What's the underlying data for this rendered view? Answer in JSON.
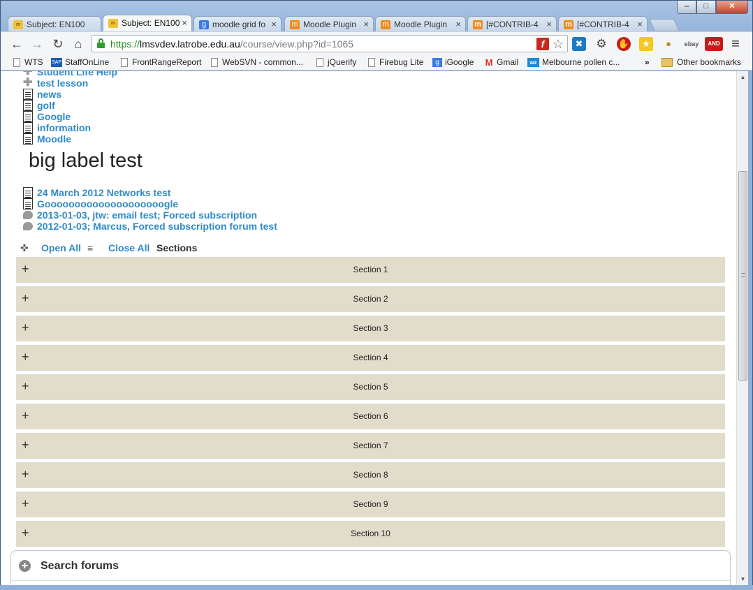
{
  "window": {
    "min": "–",
    "max": "□",
    "close": "✕"
  },
  "tabs": [
    {
      "title": "Subject: EN100",
      "icon": "moodle-icon",
      "active": false
    },
    {
      "title": "Subject: EN100",
      "icon": "moodle-icon",
      "active": true
    },
    {
      "title": "moodle grid fo",
      "icon": "google-icon",
      "active": false
    },
    {
      "title": "Moodle Plugin",
      "icon": "moodle-hat-icon",
      "active": false
    },
    {
      "title": "Moodle Plugin",
      "icon": "moodle-hat-icon",
      "active": false
    },
    {
      "title": "[#CONTRIB-4",
      "icon": "moodle-m-icon",
      "active": false
    },
    {
      "title": "[#CONTRIB-4",
      "icon": "moodle-m-icon",
      "active": false
    }
  ],
  "tab_close": "×",
  "nav": {
    "back": "←",
    "forward": "→",
    "reload": "↻",
    "home": "⌂"
  },
  "address": {
    "protocol": "https://",
    "host": "lmsvdev.latrobe.edu.au",
    "path": "/course/view.php?id=1065"
  },
  "toolbar_icons": {
    "flash": "f",
    "star": "☆",
    "ext1": "✖",
    "settings": "⚙",
    "adblock": "✋",
    "ext2": "★",
    "cookie": "●",
    "ebay": "ebay",
    "and": "AND",
    "menu": "≡"
  },
  "bookmarks": [
    {
      "label": "WTS",
      "icon": "page-icon"
    },
    {
      "label": "StaffOnLine",
      "icon": "sap-icon"
    },
    {
      "label": "FrontRangeReport",
      "icon": "page-icon"
    },
    {
      "label": "WebSVN - common...",
      "icon": "page-icon"
    },
    {
      "label": "jQuerify",
      "icon": "page-icon"
    },
    {
      "label": "Firebug Lite",
      "icon": "page-icon"
    },
    {
      "label": "iGoogle",
      "icon": "google-icon"
    },
    {
      "label": "Gmail",
      "icon": "gmail-icon"
    },
    {
      "label": "Melbourne pollen c...",
      "icon": "wz-icon"
    }
  ],
  "bookmarks_overflow": "»",
  "other_bookmarks": "Other bookmarks",
  "resources_top": [
    {
      "label": "Student Life Help",
      "type": "lesson"
    },
    {
      "label": "test lesson",
      "type": "lesson"
    },
    {
      "label": "news",
      "type": "doc"
    },
    {
      "label": "golf",
      "type": "doc"
    },
    {
      "label": "Google",
      "type": "doc"
    },
    {
      "label": "information",
      "type": "doc"
    },
    {
      "label": "Moodle",
      "type": "doc"
    }
  ],
  "big_label": "big label test",
  "resources_bottom": [
    {
      "label": "24 March 2012 Networks test",
      "type": "doc"
    },
    {
      "label": "Goooooooooooooooooooogle",
      "type": "doc"
    },
    {
      "label": "2013-01-03, jtw: email test; Forced subscription",
      "type": "forum"
    },
    {
      "label": "2012-01-03; Marcus, Forced subscription forum test",
      "type": "forum"
    }
  ],
  "open_close": {
    "open_all": "Open All",
    "close_all": "Close All",
    "sections": "Sections"
  },
  "sections": [
    "Section 1",
    "Section 2",
    "Section 3",
    "Section 4",
    "Section 5",
    "Section 6",
    "Section 7",
    "Section 8",
    "Section 9",
    "Section 10"
  ],
  "section_toggle": "+",
  "search_block": {
    "title": "Search forums",
    "toggle": "+"
  },
  "colors": {
    "link": "#2f8bc9",
    "section_bg": "#e2dccb"
  }
}
